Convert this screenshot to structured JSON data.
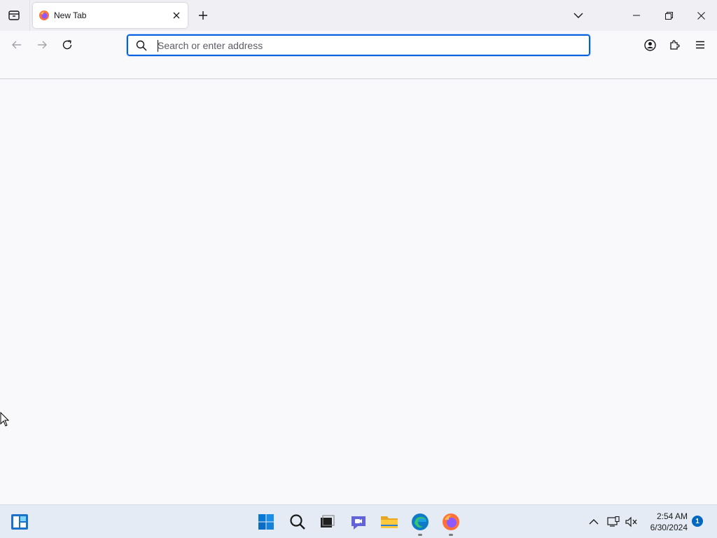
{
  "browser": {
    "tab": {
      "title": "New Tab",
      "favicon": "firefox-icon"
    },
    "buttons": {
      "tab_list": "firefox-view-icon",
      "new_tab": "plus-icon",
      "list_all_tabs": "chevron-down-icon",
      "minimize": "minimize-icon",
      "maximize": "restore-icon",
      "close": "close-icon"
    },
    "nav": {
      "back": "back-arrow-icon",
      "forward": "forward-arrow-icon",
      "reload": "reload-icon"
    },
    "urlbar": {
      "value": "",
      "placeholder": "Search or enter address"
    },
    "toolbar": {
      "account": "account-icon",
      "extensions": "extensions-icon",
      "menu": "hamburger-menu-icon"
    },
    "colors": {
      "accent": "#0061e0",
      "tabstrip_bg": "#f0f0f4",
      "content_bg": "#f9f9fb"
    }
  },
  "taskbar": {
    "apps": [
      "widgets-icon",
      "start-icon",
      "search-icon",
      "task-view-icon",
      "chat-icon",
      "file-explorer-icon",
      "edge-icon",
      "firefox-icon"
    ],
    "clock": {
      "time": "2:54 AM",
      "date": "6/30/2024"
    },
    "notification_count": "1"
  }
}
